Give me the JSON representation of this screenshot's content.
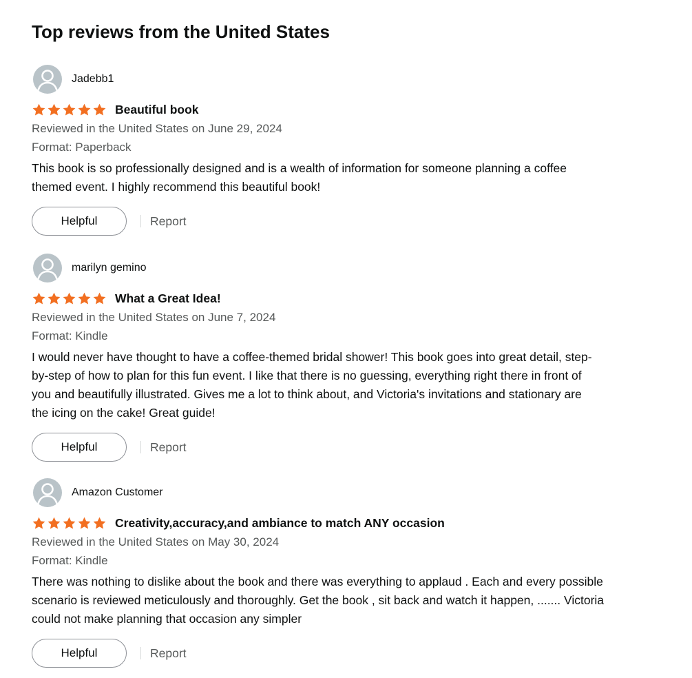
{
  "section": {
    "title": "Top reviews from the United States"
  },
  "colors": {
    "star": "#f26f21",
    "avatar_bg": "#b9c3c8",
    "meta_text": "#565959"
  },
  "reviews": [
    {
      "profile_name": "Jadebb1",
      "rating": 5,
      "title": "Beautiful book",
      "reviewed": "Reviewed in the United States on June 29, 2024",
      "format": "Format: Paperback",
      "body": [
        "This book is so professionally designed and is a wealth of information for someone planning a coffee",
        "themed event. I highly recommend this beautiful book!"
      ],
      "helpful_label": "Helpful",
      "report_label": "Report"
    },
    {
      "profile_name": "marilyn gemino",
      "rating": 5,
      "title": "What a Great Idea!",
      "reviewed": "Reviewed in the United States on June 7, 2024",
      "format": "Format: Kindle",
      "body": [
        "I would never have thought to have a coffee-themed bridal shower! This book goes into great detail, step-",
        "by-step of how to plan for this fun event. I like that there is no guessing, everything right there in front of",
        "you and beautifully illustrated. Gives me a lot to think about, and Victoria's invitations and stationary are",
        "the icing on the cake! Great guide!"
      ],
      "helpful_label": "Helpful",
      "report_label": "Report"
    },
    {
      "profile_name": "Amazon Customer",
      "rating": 5,
      "title": "Creativity,accuracy,and ambiance to match ANY occasion",
      "reviewed": "Reviewed in the United States on May 30, 2024",
      "format": "Format: Kindle",
      "body": [
        "There was nothing to dislike about the book and there was everything to applaud . Each and every possible",
        "scenario is reviewed meticulously and thoroughly. Get the book , sit back and watch it happen, ....... Victoria",
        "could not make planning that occasion any simpler"
      ],
      "helpful_label": "Helpful",
      "report_label": "Report"
    }
  ]
}
